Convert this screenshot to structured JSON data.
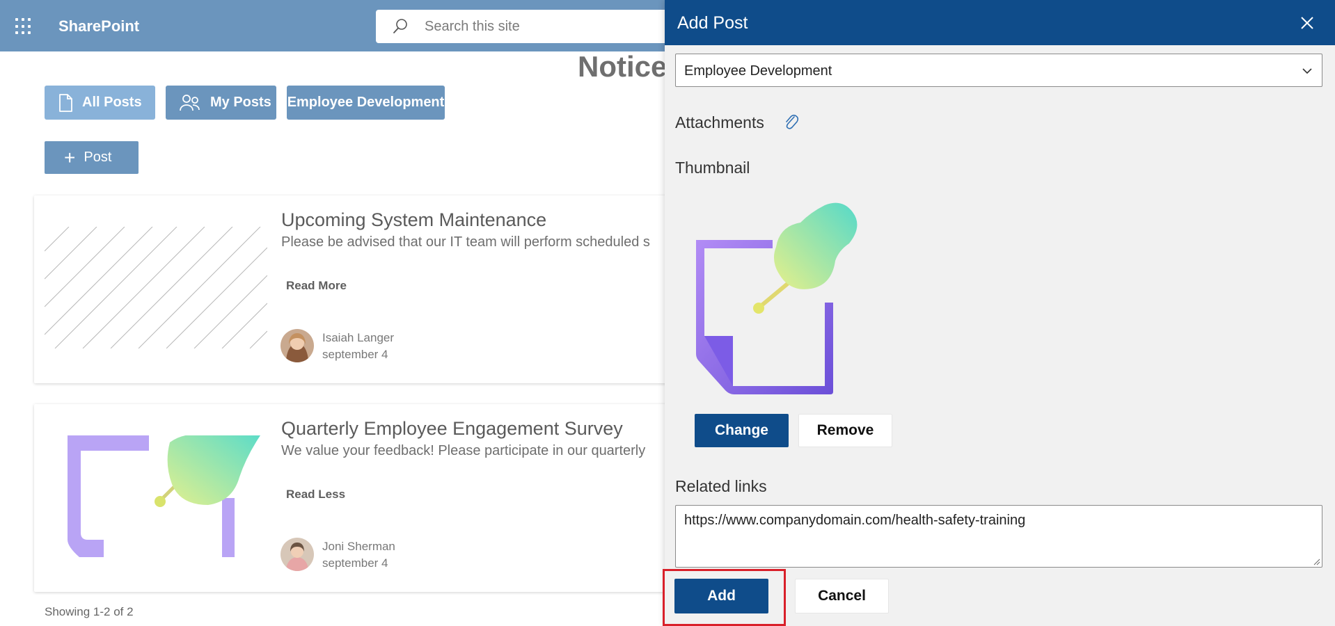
{
  "topbar": {
    "app_name": "SharePoint",
    "search_placeholder": "Search this site"
  },
  "main": {
    "page_title": "Notice",
    "filters": {
      "all_posts": "All Posts",
      "my_posts": "My Posts",
      "employee_development": "Employee Development"
    },
    "post_button": "Post",
    "cards": [
      {
        "title": "Upcoming System Maintenance",
        "description": "Please be advised that our IT team will perform scheduled s",
        "link": "Read More",
        "author": "Isaiah Langer",
        "date": "september 4"
      },
      {
        "title": "Quarterly Employee Engagement Survey",
        "description": "We value your feedback! Please participate in our quarterly",
        "link": "Read Less",
        "author": "Joni Sherman",
        "date": "september 4"
      }
    ],
    "footer_text": "Showing 1-2 of 2"
  },
  "panel": {
    "title": "Add Post",
    "category_selected": "Employee Development",
    "attachments_label": "Attachments",
    "thumbnail_label": "Thumbnail",
    "change_button": "Change",
    "remove_button": "Remove",
    "related_links_label": "Related links",
    "related_links_value": "https://www.companydomain.com/health-safety-training",
    "add_button": "Add",
    "cancel_button": "Cancel"
  },
  "colors": {
    "topbar": "#6b95bd",
    "panel_header": "#0f4c8a",
    "filter_active": "#89b2d9",
    "highlight": "#d9202a"
  },
  "icons": {
    "waffle": "app-launcher-icon",
    "search": "search-icon",
    "all_posts": "document-icon",
    "my_posts": "people-icon",
    "post": "plus-icon",
    "close": "close-icon",
    "dropdown": "chevron-down-icon",
    "attachment": "paperclip-icon",
    "thumbnail": "pushpin-note-icon"
  }
}
